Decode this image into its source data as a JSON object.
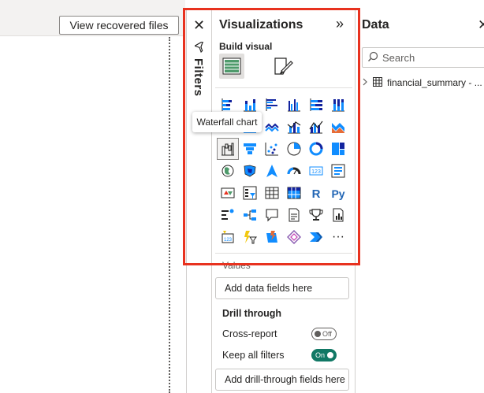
{
  "toolbar": {
    "recover_label": "View recovered files"
  },
  "filters": {
    "label": "Filters"
  },
  "visualizations": {
    "title": "Visualizations",
    "build_visual_label": "Build visual",
    "tooltip": "Waterfall chart",
    "more_label": "···",
    "values_label": "Values",
    "values_placeholder": "Add data fields here",
    "drill_through": {
      "title": "Drill through",
      "cross_report": {
        "label": "Cross-report",
        "state": "Off"
      },
      "keep_filters": {
        "label": "Keep all filters",
        "state": "On"
      },
      "placeholder": "Add drill-through fields here"
    }
  },
  "data_pane": {
    "title": "Data",
    "search_placeholder": "Search",
    "table_name": "financial_summary - ..."
  },
  "colors": {
    "accent_blue": "#118dff",
    "highlight_red": "#e8321f",
    "toggle_on": "#117865"
  }
}
